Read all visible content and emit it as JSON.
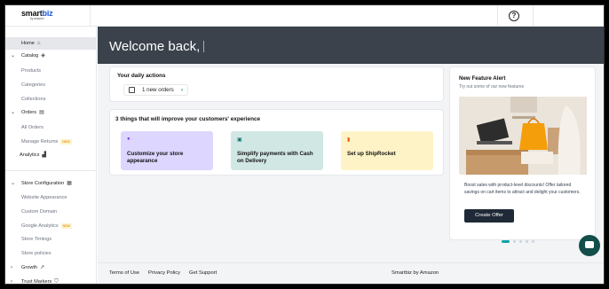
{
  "header": {
    "logo_main": "smart",
    "logo_accent": "biz",
    "logo_sub": "by amazon",
    "help_glyph": "?"
  },
  "sidebar": {
    "items": [
      {
        "label": "Home",
        "icon": "home-icon"
      },
      {
        "label": "Catalog",
        "icon": "tag-icon"
      },
      {
        "label": "Products"
      },
      {
        "label": "Categories"
      },
      {
        "label": "Collections"
      },
      {
        "label": "Orders",
        "icon": "clipboard-icon"
      },
      {
        "label": "All Orders"
      },
      {
        "label": "Manage Returns",
        "badge": "NEW"
      },
      {
        "label": "Analytics",
        "icon": "bar-chart-icon"
      },
      {
        "label": "Store Configuration",
        "icon": "store-icon"
      },
      {
        "label": "Website Appearance"
      },
      {
        "label": "Custom Domain"
      },
      {
        "label": "Google Analytics",
        "badge": "NEW"
      },
      {
        "label": "Store Timings"
      },
      {
        "label": "Store policies"
      },
      {
        "label": "Growth",
        "icon": "trend-up-icon"
      },
      {
        "label": "Trust Markers",
        "icon": "shield-icon"
      }
    ]
  },
  "main": {
    "welcome": "Welcome back,",
    "daily": {
      "title": "Your daily actions",
      "orders_label": "1 new orders",
      "arrow": "›"
    },
    "improve": {
      "title": "3 things that will improve your customers' experience",
      "tiles": [
        {
          "label": "Customize your store appearance",
          "bg": "#ddd6fe",
          "icon": "palette-icon"
        },
        {
          "label": "Simplify payments with Cash on Delivery",
          "bg": "#d1e7e4",
          "icon": "cash-icon"
        },
        {
          "label": "Set up ShipRocket",
          "bg": "#fef3c7",
          "icon": "truck-icon"
        }
      ]
    },
    "feature": {
      "title": "New Feature Alert",
      "subtitle": "Try out some of our new features",
      "text": "Boost sales with product-level discounts! Offer tailored savings on cart items to attract and delight your customers.",
      "button": "Create Offer"
    }
  },
  "footer": {
    "terms": "Terms of Use",
    "privacy": "Privacy Policy",
    "support": "Get Support",
    "brand": "Smartbiz by Amazon"
  }
}
